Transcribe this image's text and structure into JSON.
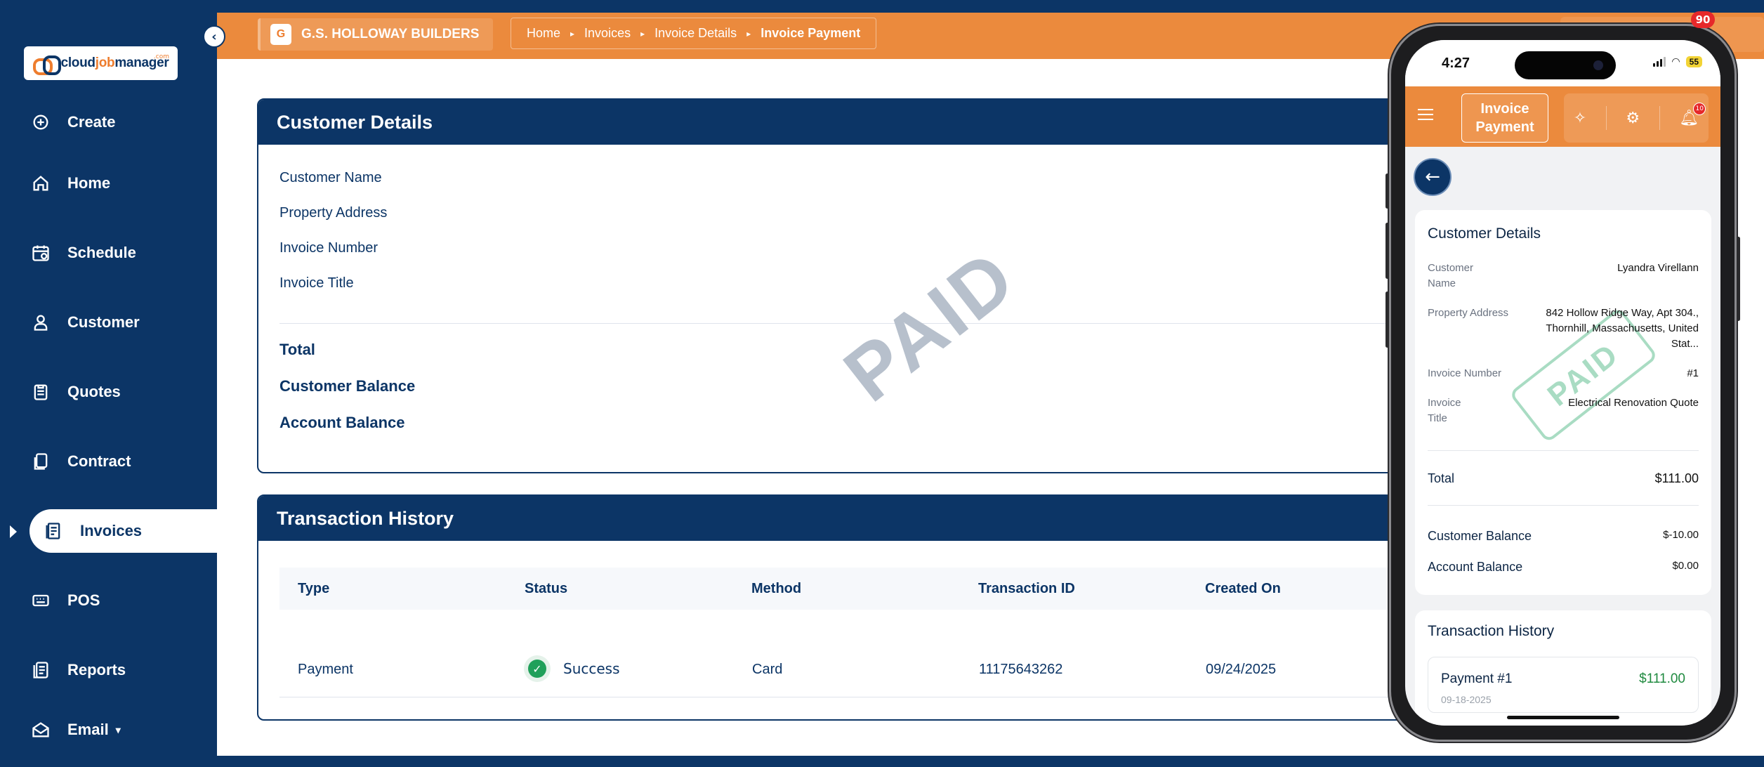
{
  "app": {
    "logo": {
      "prefix": "cloud",
      "highlight": "job",
      "suffix": "manager",
      "tld": ".com"
    }
  },
  "sidebar": {
    "items": [
      {
        "label": "Create",
        "icon": "plus-circle-icon"
      },
      {
        "label": "Home",
        "icon": "home-icon"
      },
      {
        "label": "Schedule",
        "icon": "calendar-icon"
      },
      {
        "label": "Customer",
        "icon": "user-icon"
      },
      {
        "label": "Quotes",
        "icon": "clipboard-icon"
      },
      {
        "label": "Contract",
        "icon": "document-copy-icon"
      },
      {
        "label": "Invoices",
        "icon": "invoice-icon",
        "active": true
      },
      {
        "label": "POS",
        "icon": "keyboard-icon"
      },
      {
        "label": "Reports",
        "icon": "reports-icon"
      },
      {
        "label": "Email",
        "icon": "email-icon",
        "has_dropdown": true
      }
    ]
  },
  "topbar": {
    "company_initial": "G",
    "company_name": "G.S. HOLLOWAY BUILDERS",
    "breadcrumbs": [
      "Home",
      "Invoices",
      "Invoice Details",
      "Invoice Payment"
    ],
    "notification_count": "90"
  },
  "customer_details": {
    "title": "Customer Details",
    "labels": {
      "name": "Customer Name",
      "address": "Property Address",
      "invoice_number": "Invoice Number",
      "invoice_title": "Invoice Title",
      "total": "Total",
      "customer_balance": "Customer Balance",
      "account_balance": "Account Balance"
    },
    "stamp": "PAID"
  },
  "transactions": {
    "title": "Transaction History",
    "columns": [
      "Type",
      "Status",
      "Method",
      "Transaction ID",
      "Created On"
    ],
    "rows": [
      {
        "type": "Payment",
        "status": "Success",
        "method": "Card",
        "transaction_id": "11175643262",
        "created_on": "09/24/2025"
      }
    ]
  },
  "phone": {
    "time": "4:27",
    "battery": "55",
    "header_title": "Invoice Payment",
    "notification_count": "10",
    "customer_details": {
      "title": "Customer Details",
      "name_label": "Customer Name",
      "name_value": "Lyandra Virellann",
      "address_label": "Property Address",
      "address_value": "842 Hollow Ridge Way, Apt 304., Thornhill, Massachusetts, United Stat...",
      "invoice_number_label": "Invoice Number",
      "invoice_number_value": "#1",
      "invoice_title_label": "Invoice Title",
      "invoice_title_value": "Electrical Renovation Quote",
      "stamp": "PAID",
      "total_label": "Total",
      "total_value": "$111.00",
      "customer_balance_label": "Customer Balance",
      "customer_balance_value": "$-10.00",
      "account_balance_label": "Account Balance",
      "account_balance_value": "$0.00"
    },
    "transaction_history": {
      "title": "Transaction History",
      "item_title": "Payment #1",
      "item_amount": "$111.00",
      "item_date": "09-18-2025"
    }
  },
  "colors": {
    "navy": "#0c3566",
    "orange": "#eb8a3d",
    "success": "#20a05a"
  }
}
